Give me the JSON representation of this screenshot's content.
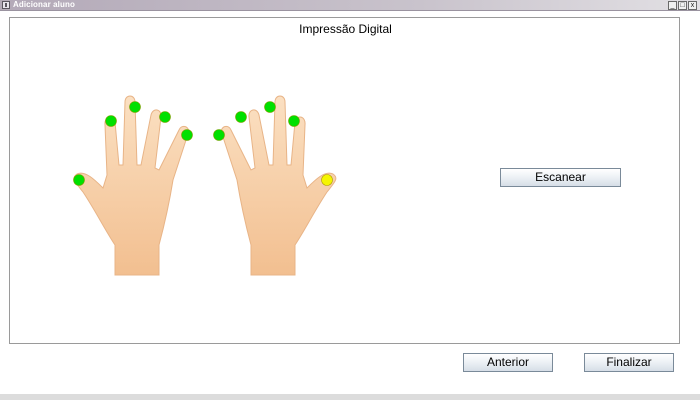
{
  "window": {
    "title": "Adicionar aluno",
    "controls": {
      "minimize": "_",
      "maximize": "□",
      "close": "x"
    }
  },
  "panel": {
    "title": "Impressão Digital",
    "scan_button": "Escanear"
  },
  "fingers": {
    "left_hand": [
      {
        "finger": "pinky",
        "status": "captured",
        "color": "#00e000"
      },
      {
        "finger": "ring",
        "status": "captured",
        "color": "#00e000"
      },
      {
        "finger": "middle",
        "status": "captured",
        "color": "#00e000"
      },
      {
        "finger": "index",
        "status": "captured",
        "color": "#00e000"
      },
      {
        "finger": "thumb",
        "status": "captured",
        "color": "#00e000"
      }
    ],
    "right_hand": [
      {
        "finger": "thumb",
        "status": "pending",
        "color": "#f5f500"
      },
      {
        "finger": "index",
        "status": "captured",
        "color": "#00e000"
      },
      {
        "finger": "middle",
        "status": "captured",
        "color": "#00e000"
      },
      {
        "finger": "ring",
        "status": "captured",
        "color": "#00e000"
      },
      {
        "finger": "pinky",
        "status": "captured",
        "color": "#00e000"
      }
    ]
  },
  "footer": {
    "previous_button": "Anterior",
    "finish_button": "Finalizar"
  },
  "colors": {
    "skin": "#f7d0a8",
    "captured": "#00e000",
    "pending": "#f5f500"
  }
}
